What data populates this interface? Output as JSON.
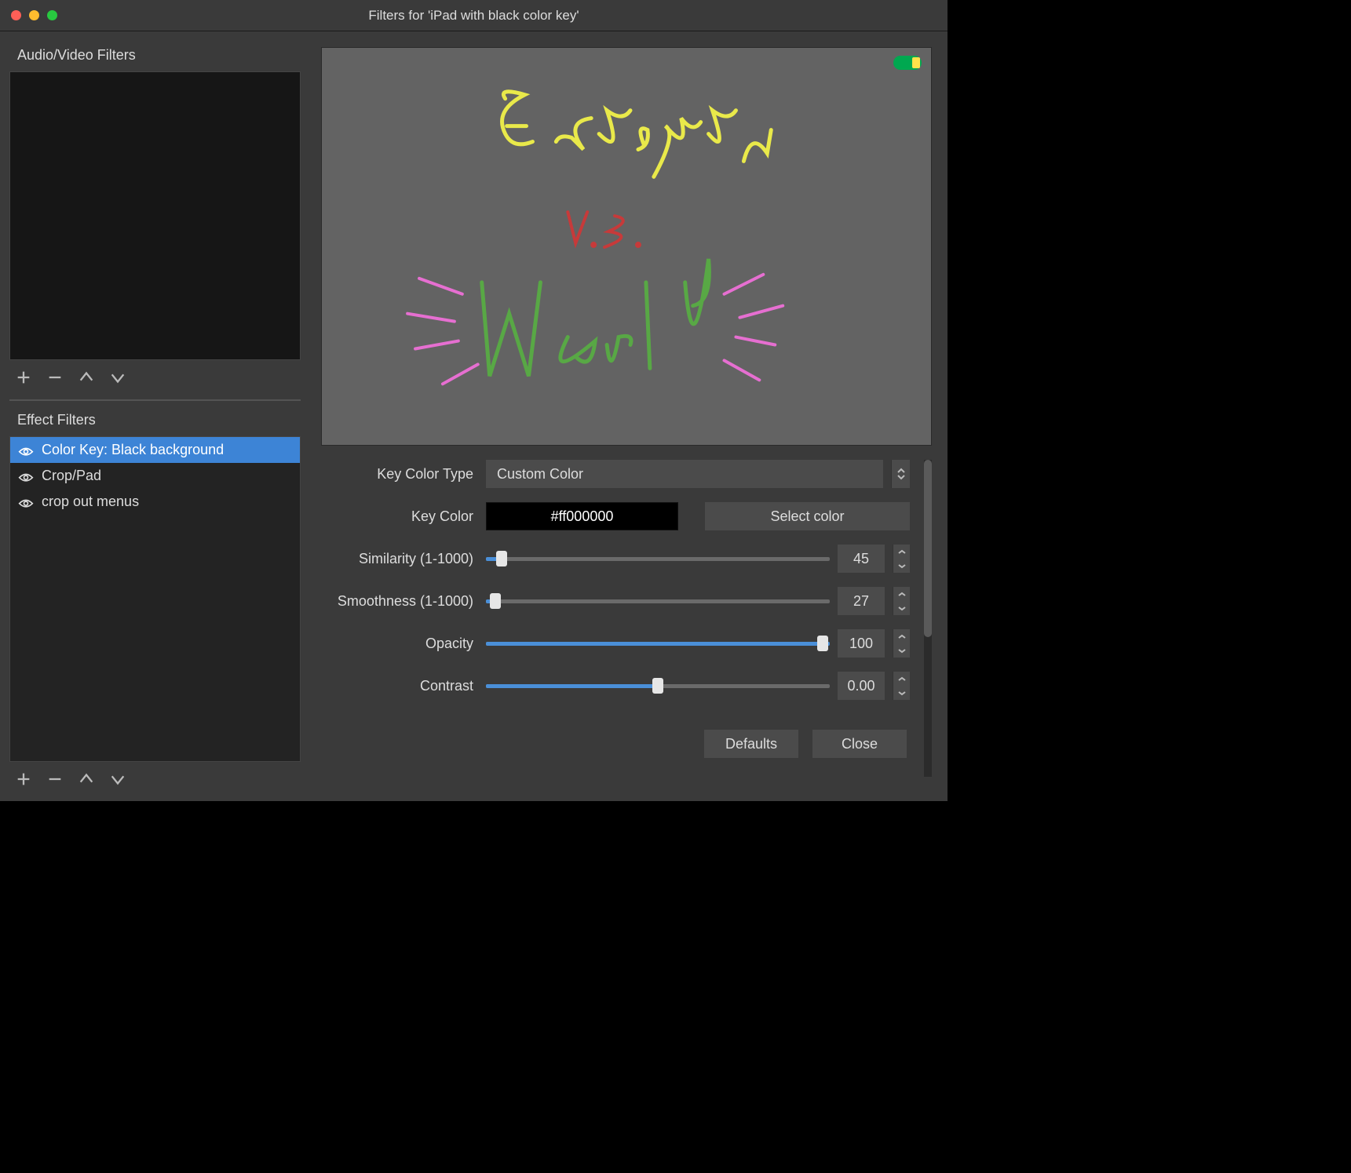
{
  "window": {
    "title": "Filters for 'iPad with black color key'"
  },
  "left": {
    "audio_video_label": "Audio/Video Filters",
    "effect_label": "Effect Filters",
    "effects": [
      {
        "label": "Color Key: Black background",
        "selected": true
      },
      {
        "label": "Crop/Pad",
        "selected": false
      },
      {
        "label": "crop out menus",
        "selected": false
      }
    ]
  },
  "preview": {
    "line1": "Execgen",
    "line2": "V.S.",
    "line3": "World"
  },
  "controls": {
    "key_color_type": {
      "label": "Key Color Type",
      "value": "Custom Color"
    },
    "key_color": {
      "label": "Key Color",
      "value": "#ff000000",
      "select_btn": "Select color"
    },
    "similarity": {
      "label": "Similarity (1-1000)",
      "value": 45,
      "min": 1,
      "max": 1000
    },
    "smoothness": {
      "label": "Smoothness (1-1000)",
      "value": 27,
      "min": 1,
      "max": 1000
    },
    "opacity": {
      "label": "Opacity",
      "value": 100,
      "min": 0,
      "max": 100
    },
    "contrast": {
      "label": "Contrast",
      "value": "0.00",
      "fill_pct": 50
    }
  },
  "footer": {
    "defaults": "Defaults",
    "close": "Close"
  }
}
